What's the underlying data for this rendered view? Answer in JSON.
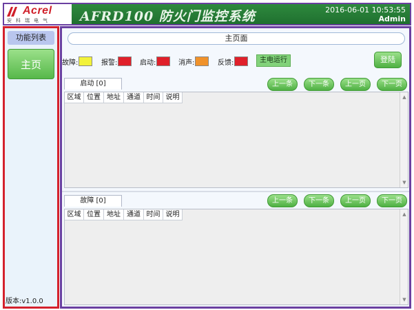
{
  "header": {
    "logo_text": "Acrel",
    "logo_sub": "安科瑞电气",
    "title": "AFRD100 防火门监控系统",
    "datetime": "2016-06-01 10:53:55",
    "user": "Admin"
  },
  "sidebar": {
    "heading": "功能列表",
    "items": [
      {
        "label": "主页"
      }
    ],
    "version": "版本:v1.0.0"
  },
  "main": {
    "title": "主页面",
    "legend": [
      {
        "label": "故障:",
        "color": "#f2f23a"
      },
      {
        "label": "报警:",
        "color": "#e0202a"
      },
      {
        "label": "启动:",
        "color": "#e0202a"
      },
      {
        "label": "消声:",
        "color": "#f0922a"
      },
      {
        "label": "反馈:",
        "color": "#e0202a"
      }
    ],
    "power_status": "主电运行",
    "login_label": "登陆",
    "pager": {
      "prev_item": "上一条",
      "next_item": "下一条",
      "prev_page": "上一页",
      "next_page": "下一页"
    },
    "columns": [
      "区域",
      "位置",
      "地址",
      "通道",
      "时间",
      "说明"
    ],
    "panels": [
      {
        "tab": "启动 [0]",
        "rows": []
      },
      {
        "tab": "故障 [0]",
        "rows": []
      }
    ]
  }
}
